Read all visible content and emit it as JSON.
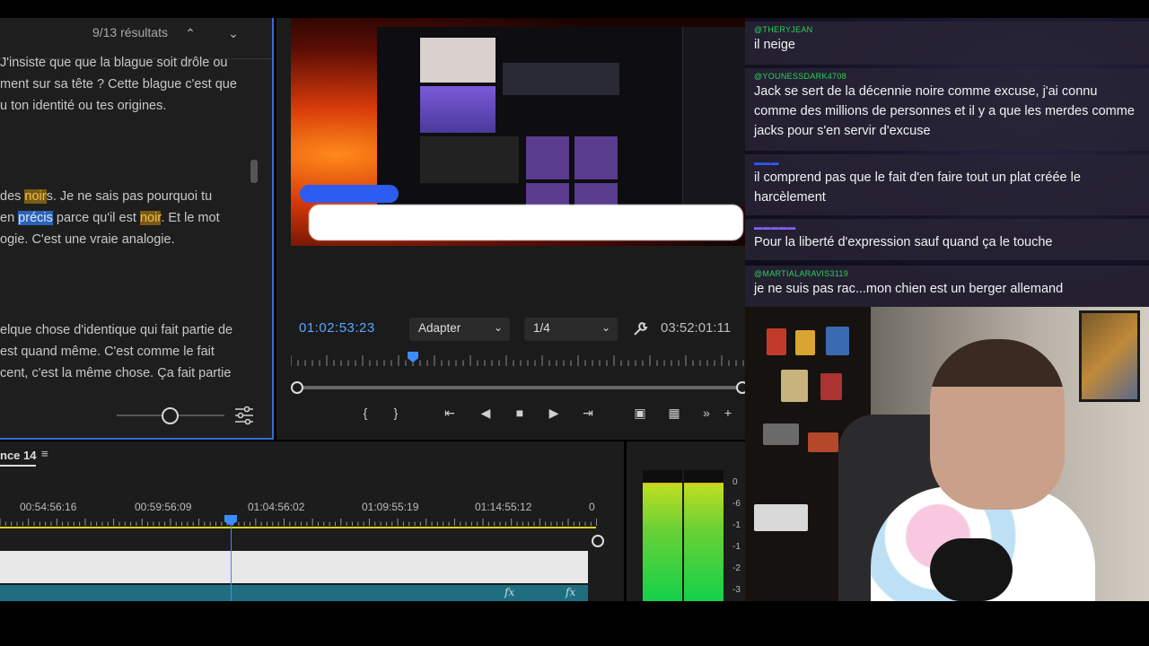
{
  "transcript": {
    "results": "9/13 résultats",
    "paragraph1": [
      "J'insiste que que la blague soit drôle ou",
      "ment sur sa tête ? Cette blague c'est que",
      "u ton identité ou tes origines."
    ],
    "paragraph2": {
      "line1_pre": "des ",
      "line1_hl": "noir",
      "line1_post": "s. Je ne sais pas pourquoi tu",
      "line2_pre": "en ",
      "line2_hl_blue": "précis",
      "line2_mid": " parce qu'il est ",
      "line2_hl": "noir",
      "line2_post": ". Et le mot",
      "line3": "ogie. C'est une vraie analogie."
    },
    "paragraph3": [
      "elque chose d'identique qui fait partie de",
      "est quand même. C'est comme le fait",
      "cent, c'est la même chose. Ça fait partie"
    ]
  },
  "monitor": {
    "current_timecode": "01:02:53:23",
    "fit_select": "Adapter",
    "resolution_select": "1/4",
    "duration": "03:52:01:11"
  },
  "timeline": {
    "sequence_name": "nce 14",
    "timecodes": [
      "00:54:56:16",
      "00:59:56:09",
      "01:04:56:02",
      "01:09:55:19",
      "01:14:55:12",
      "0"
    ],
    "fx_label": "fx"
  },
  "meter": {
    "labels": [
      "0",
      "-6",
      "-1",
      "-1",
      "-2",
      "-3"
    ]
  },
  "chat": {
    "messages": [
      {
        "user": "@THERYJEAN",
        "text": "il neige",
        "user_color": "#29d35a"
      },
      {
        "user": "@YOUNESSDARK4708",
        "text": "Jack se sert de la décennie noire comme excuse, j'ai connu comme des millions de personnes et il y a que les merdes comme jacks pour s'en servir d'excuse",
        "user_color": "#29d35a"
      },
      {
        "user": "",
        "text": "il comprend pas que le fait d'en faire tout un plat créée le harcèlement",
        "user_color": "#2f5bff"
      },
      {
        "user": "",
        "text": "Pour la liberté d'expression sauf quand ça le touche",
        "user_color": "#8b5cff"
      },
      {
        "user": "@MARTIALARAVIS3119",
        "text": "je ne suis pas rac...mon chien est un berger allemand",
        "user_color": "#29d35a"
      }
    ]
  }
}
